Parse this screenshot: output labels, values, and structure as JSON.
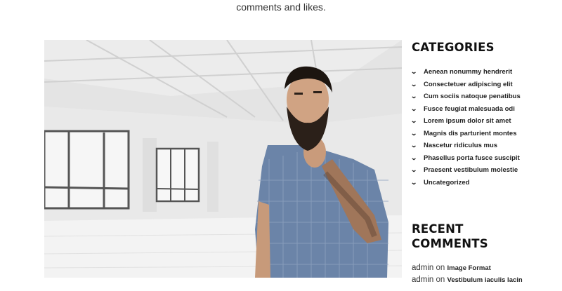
{
  "intro": {
    "text": "comments and likes."
  },
  "sidebar": {
    "categories_title": "CATEGORIES",
    "categories": [
      "Aenean nonummy hendrerit",
      "Consectetuer adipiscing elit",
      "Cum sociis natoque penatibus",
      "Fusce feugiat malesuada odi",
      "Lorem ipsum dolor sit amet",
      "Magnis dis parturient montes",
      "Nascetur ridiculus mus",
      "Phasellus porta fusce suscipit",
      "Praesent vestibulum molestie",
      "Uncategorized"
    ],
    "recent_comments_title_line1": "RECENT",
    "recent_comments_title_line2": "COMMENTS",
    "recent_comments": [
      {
        "author": "admin",
        "on": "on",
        "post": "Image Format"
      },
      {
        "author": "admin",
        "on": "on",
        "post": "Vestibulum iaculis lacin"
      }
    ]
  },
  "icons": {
    "category_bullet": "chevron-down-icon"
  },
  "colors": {
    "text": "#222222",
    "background": "#ffffff"
  }
}
